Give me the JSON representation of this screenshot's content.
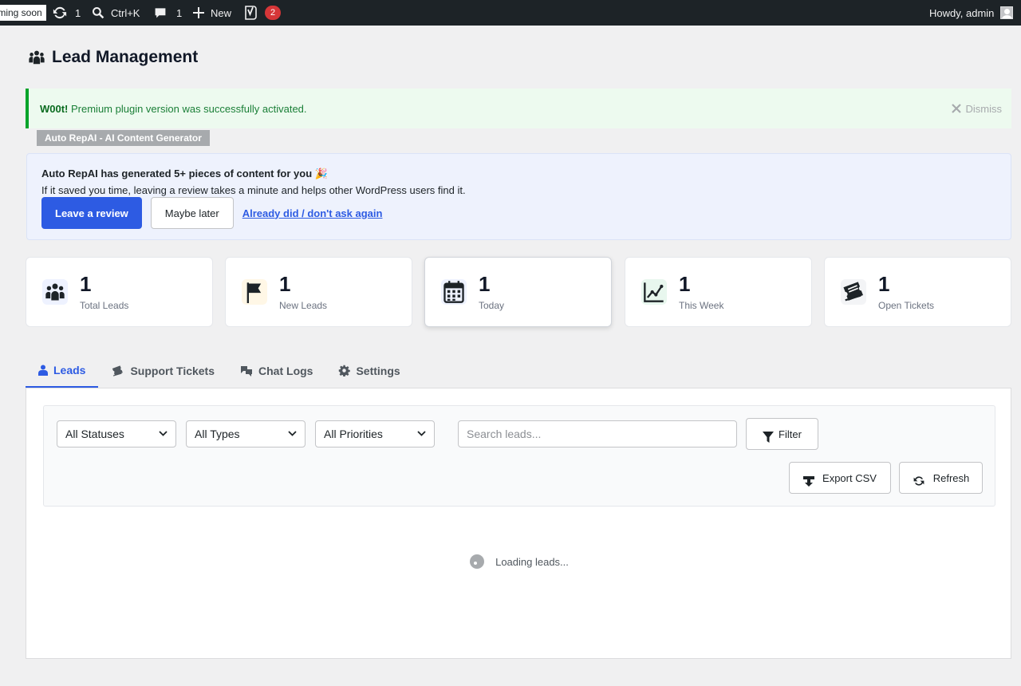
{
  "admin_bar": {
    "coming_soon": "Coming soon",
    "updates_count": "1",
    "search_shortcut": "Ctrl+K",
    "comments_count": "1",
    "new_label": "New",
    "seo_badge": "2",
    "greeting": "Howdy, admin"
  },
  "page": {
    "title": "Lead Management"
  },
  "notice": {
    "strong": "W00t!",
    "message": " Premium plugin version was successfully activated.",
    "dismiss": "Dismiss"
  },
  "plugin_tag": "Auto RepAI - AI Content Generator",
  "review": {
    "headline": "Auto RepAI has generated 5+ pieces of content for you 🎉",
    "body": "If it saved you time, leaving a review takes a minute and helps other WordPress users find it.",
    "leave_review": "Leave a review",
    "maybe_later": "Maybe later",
    "dont_ask": "Already did / don't ask again"
  },
  "stats": [
    {
      "value": "1",
      "label": "Total Leads",
      "icon": "users-icon"
    },
    {
      "value": "1",
      "label": "New Leads",
      "icon": "flag-icon"
    },
    {
      "value": "1",
      "label": "Today",
      "icon": "calendar-icon"
    },
    {
      "value": "1",
      "label": "This Week",
      "icon": "chart-line-icon"
    },
    {
      "value": "1",
      "label": "Open Tickets",
      "icon": "tickets-icon"
    }
  ],
  "tabs": [
    {
      "label": "Leads",
      "icon": "user-icon",
      "active": true
    },
    {
      "label": "Support Tickets",
      "icon": "ticket-icon",
      "active": false
    },
    {
      "label": "Chat Logs",
      "icon": "chat-icon",
      "active": false
    },
    {
      "label": "Settings",
      "icon": "gear-icon",
      "active": false
    }
  ],
  "filters": {
    "status": "All Statuses",
    "type": "All Types",
    "priority": "All Priorities",
    "search_placeholder": "Search leads...",
    "filter_button": "Filter",
    "export_button": "Export CSV",
    "refresh_button": "Refresh"
  },
  "loading_text": "Loading leads...",
  "colors": {
    "accent": "#2d5be3",
    "success": "#00a32a",
    "badge": "#d63638",
    "admin_bar": "#1d2327"
  }
}
